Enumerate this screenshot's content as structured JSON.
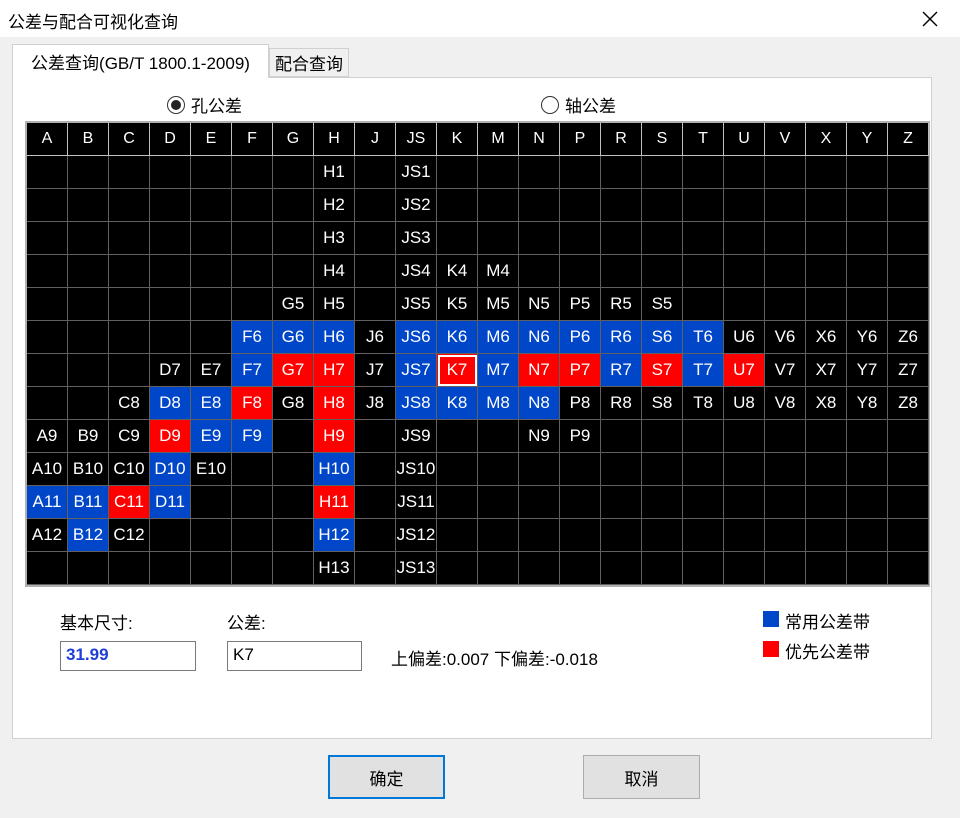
{
  "window": {
    "title": "公差与配合可视化查询"
  },
  "tabs": [
    {
      "label": "公差查询(GB/T 1800.1-2009)"
    },
    {
      "label": "配合查询"
    }
  ],
  "radios": {
    "hole": "孔公差",
    "shaft": "轴公差",
    "selected": "hole"
  },
  "columns": [
    "A",
    "B",
    "C",
    "D",
    "E",
    "F",
    "G",
    "H",
    "J",
    "JS",
    "K",
    "M",
    "N",
    "P",
    "R",
    "S",
    "T",
    "U",
    "V",
    "X",
    "Y",
    "Z"
  ],
  "colors": {
    "common": "#0046c8",
    "preferred": "#ff0000",
    "background": "#000000"
  },
  "grid": [
    [
      "",
      "",
      "",
      "",
      "",
      "",
      "",
      "H1",
      "",
      "JS1",
      "",
      "",
      "",
      "",
      "",
      "",
      "",
      "",
      "",
      "",
      "",
      ""
    ],
    [
      "",
      "",
      "",
      "",
      "",
      "",
      "",
      "H2",
      "",
      "JS2",
      "",
      "",
      "",
      "",
      "",
      "",
      "",
      "",
      "",
      "",
      "",
      ""
    ],
    [
      "",
      "",
      "",
      "",
      "",
      "",
      "",
      "H3",
      "",
      "JS3",
      "",
      "",
      "",
      "",
      "",
      "",
      "",
      "",
      "",
      "",
      "",
      ""
    ],
    [
      "",
      "",
      "",
      "",
      "",
      "",
      "",
      "H4",
      "",
      "JS4",
      "K4",
      "M4",
      "",
      "",
      "",
      "",
      "",
      "",
      "",
      "",
      "",
      ""
    ],
    [
      "",
      "",
      "",
      "",
      "",
      "",
      "G5",
      "H5",
      "",
      "JS5",
      "K5",
      "M5",
      "N5",
      "P5",
      "R5",
      "S5",
      "",
      "",
      "",
      "",
      "",
      ""
    ],
    [
      "",
      "",
      "",
      "",
      "",
      "F6",
      "G6",
      "H6",
      "J6",
      "JS6",
      "K6",
      "M6",
      "N6",
      "P6",
      "R6",
      "S6",
      "T6",
      "U6",
      "V6",
      "X6",
      "Y6",
      "Z6"
    ],
    [
      "",
      "",
      "",
      "D7",
      "E7",
      "F7",
      "G7",
      "H7",
      "J7",
      "JS7",
      "K7",
      "M7",
      "N7",
      "P7",
      "R7",
      "S7",
      "T7",
      "U7",
      "V7",
      "X7",
      "Y7",
      "Z7"
    ],
    [
      "",
      "",
      "C8",
      "D8",
      "E8",
      "F8",
      "G8",
      "H8",
      "J8",
      "JS8",
      "K8",
      "M8",
      "N8",
      "P8",
      "R8",
      "S8",
      "T8",
      "U8",
      "V8",
      "X8",
      "Y8",
      "Z8"
    ],
    [
      "A9",
      "B9",
      "C9",
      "D9",
      "E9",
      "F9",
      "",
      "H9",
      "",
      "JS9",
      "",
      "",
      "N9",
      "P9",
      "",
      "",
      "",
      "",
      "",
      "",
      "",
      ""
    ],
    [
      "A10",
      "B10",
      "C10",
      "D10",
      "E10",
      "",
      "",
      "H10",
      "",
      "JS10",
      "",
      "",
      "",
      "",
      "",
      "",
      "",
      "",
      "",
      "",
      "",
      ""
    ],
    [
      "A11",
      "B11",
      "C11",
      "D11",
      "",
      "",
      "",
      "H11",
      "",
      "JS11",
      "",
      "",
      "",
      "",
      "",
      "",
      "",
      "",
      "",
      "",
      "",
      ""
    ],
    [
      "A12",
      "B12",
      "C12",
      "",
      "",
      "",
      "",
      "H12",
      "",
      "JS12",
      "",
      "",
      "",
      "",
      "",
      "",
      "",
      "",
      "",
      "",
      "",
      ""
    ],
    [
      "",
      "",
      "",
      "",
      "",
      "",
      "",
      "H13",
      "",
      "JS13",
      "",
      "",
      "",
      "",
      "",
      "",
      "",
      "",
      "",
      "",
      "",
      ""
    ]
  ],
  "blue_cells": [
    "F6",
    "G6",
    "H6",
    "JS6",
    "K6",
    "M6",
    "N6",
    "P6",
    "R6",
    "S6",
    "T6",
    "F7",
    "JS7",
    "M7",
    "R7",
    "T7",
    "D8",
    "E8",
    "JS8",
    "K8",
    "M8",
    "N8",
    "E9",
    "F9",
    "D10",
    "H10",
    "A11",
    "B11",
    "D11",
    "B12",
    "H12"
  ],
  "red_cells": [
    "G7",
    "H7",
    "K7",
    "N7",
    "P7",
    "S7",
    "U7",
    "F8",
    "H8",
    "D9",
    "H9",
    "C11",
    "H11"
  ],
  "selected_cell": "K7",
  "form": {
    "basic_size_label": "基本尺寸:",
    "basic_size_value": "31.99",
    "tolerance_label": "公差:",
    "tolerance_value": "K7",
    "deviation_text": "上偏差:0.007 下偏差:-0.018"
  },
  "legend": [
    {
      "label": "常用公差带",
      "color": "#0046c8"
    },
    {
      "label": "优先公差带",
      "color": "#ff0000"
    }
  ],
  "buttons": {
    "ok": "确定",
    "cancel": "取消"
  }
}
